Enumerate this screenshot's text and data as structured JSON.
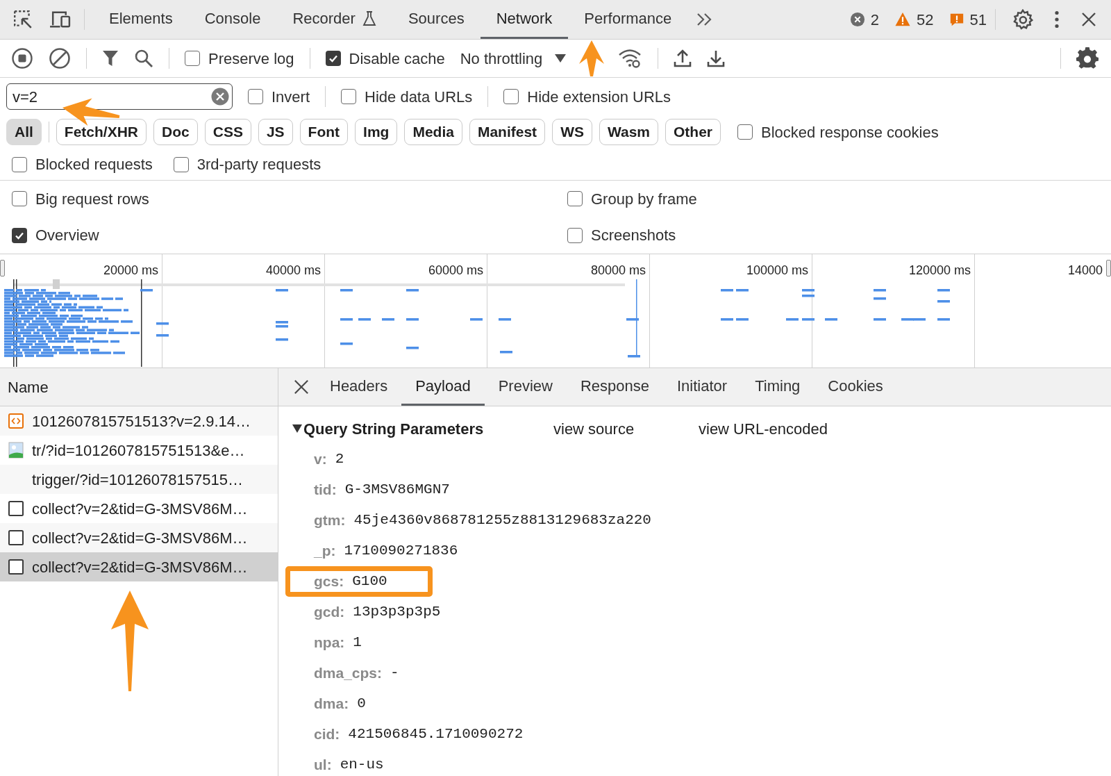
{
  "main_tabs": [
    {
      "label": "Elements",
      "selected": false
    },
    {
      "label": "Console",
      "selected": false
    },
    {
      "label": "Recorder",
      "selected": false,
      "kind": "flask"
    },
    {
      "label": "Sources",
      "selected": false
    },
    {
      "label": "Network",
      "selected": true
    },
    {
      "label": "Performance",
      "selected": false
    }
  ],
  "issue_counts": [
    {
      "kind": "error",
      "count": "2"
    },
    {
      "kind": "warning",
      "count": "52"
    },
    {
      "kind": "info",
      "count": "51"
    }
  ],
  "toolbar": {
    "preserve_log": {
      "label": "Preserve log",
      "checked": false
    },
    "disable_cache": {
      "label": "Disable cache",
      "checked": true
    },
    "throttling": "No throttling"
  },
  "filter": {
    "value": "v=2",
    "options": [
      {
        "label": "Invert",
        "checked": false
      },
      {
        "label": "Hide data URLs",
        "checked": false
      },
      {
        "label": "Hide extension URLs",
        "checked": false
      }
    ]
  },
  "type_filters": [
    {
      "label": "All",
      "selected": true
    },
    {
      "label": "Fetch/XHR",
      "selected": false
    },
    {
      "label": "Doc",
      "selected": false
    },
    {
      "label": "CSS",
      "selected": false
    },
    {
      "label": "JS",
      "selected": false
    },
    {
      "label": "Font",
      "selected": false
    },
    {
      "label": "Img",
      "selected": false
    },
    {
      "label": "Media",
      "selected": false
    },
    {
      "label": "Manifest",
      "selected": false
    },
    {
      "label": "WS",
      "selected": false
    },
    {
      "label": "Wasm",
      "selected": false
    },
    {
      "label": "Other",
      "selected": false
    }
  ],
  "blocked_response_cookies": {
    "label": "Blocked response cookies",
    "checked": false
  },
  "request_options": [
    {
      "label": "Blocked requests",
      "checked": false
    },
    {
      "label": "3rd-party requests",
      "checked": false
    }
  ],
  "settings": [
    {
      "label": "Big request rows",
      "checked": false
    },
    {
      "label": "Group by frame",
      "checked": false
    },
    {
      "label": "Overview",
      "checked": true
    },
    {
      "label": "Screenshots",
      "checked": false
    }
  ],
  "timeline_ticks": [
    "20000 ms",
    "40000 ms",
    "60000 ms",
    "80000 ms",
    "100000 ms",
    "120000 ms",
    "14000"
  ],
  "name_column": "Name",
  "requests": [
    {
      "name": "1012607815751513?v=2.9.14…",
      "kind": "script",
      "selected": false
    },
    {
      "name": "tr/?id=1012607815751513&e…",
      "kind": "image",
      "selected": false
    },
    {
      "name": "trigger/?id=10126078157515…",
      "kind": "none",
      "selected": false
    },
    {
      "name": "collect?v=2&tid=G-3MSV86M…",
      "kind": "other",
      "selected": false
    },
    {
      "name": "collect?v=2&tid=G-3MSV86M…",
      "kind": "other",
      "selected": false
    },
    {
      "name": "collect?v=2&tid=G-3MSV86M…",
      "kind": "other",
      "selected": true
    }
  ],
  "detail_tabs": [
    {
      "label": "Headers",
      "selected": false
    },
    {
      "label": "Payload",
      "selected": true
    },
    {
      "label": "Preview",
      "selected": false
    },
    {
      "label": "Response",
      "selected": false
    },
    {
      "label": "Initiator",
      "selected": false
    },
    {
      "label": "Timing",
      "selected": false
    },
    {
      "label": "Cookies",
      "selected": false
    }
  ],
  "payload": {
    "title": "Query String Parameters",
    "expanded": true,
    "links": [
      "view source",
      "view URL-encoded"
    ],
    "params": [
      {
        "key": "v:",
        "value": "2",
        "highlighted": false
      },
      {
        "key": "tid:",
        "value": "G-3MSV86MGN7",
        "highlighted": false
      },
      {
        "key": "gtm:",
        "value": "45je4360v868781255z8813129683za220",
        "highlighted": false
      },
      {
        "key": "_p:",
        "value": "1710090271836",
        "highlighted": false
      },
      {
        "key": "gcs:",
        "value": "G100",
        "highlighted": true
      },
      {
        "key": "gcd:",
        "value": "13p3p3p3p5",
        "highlighted": false
      },
      {
        "key": "npa:",
        "value": "1",
        "highlighted": false
      },
      {
        "key": "dma_cps:",
        "value": "-",
        "highlighted": false
      },
      {
        "key": "dma:",
        "value": "0",
        "highlighted": false
      },
      {
        "key": "cid:",
        "value": "421506845.1710090272",
        "highlighted": false
      },
      {
        "key": "ul:",
        "value": "en-us",
        "highlighted": false
      }
    ]
  }
}
